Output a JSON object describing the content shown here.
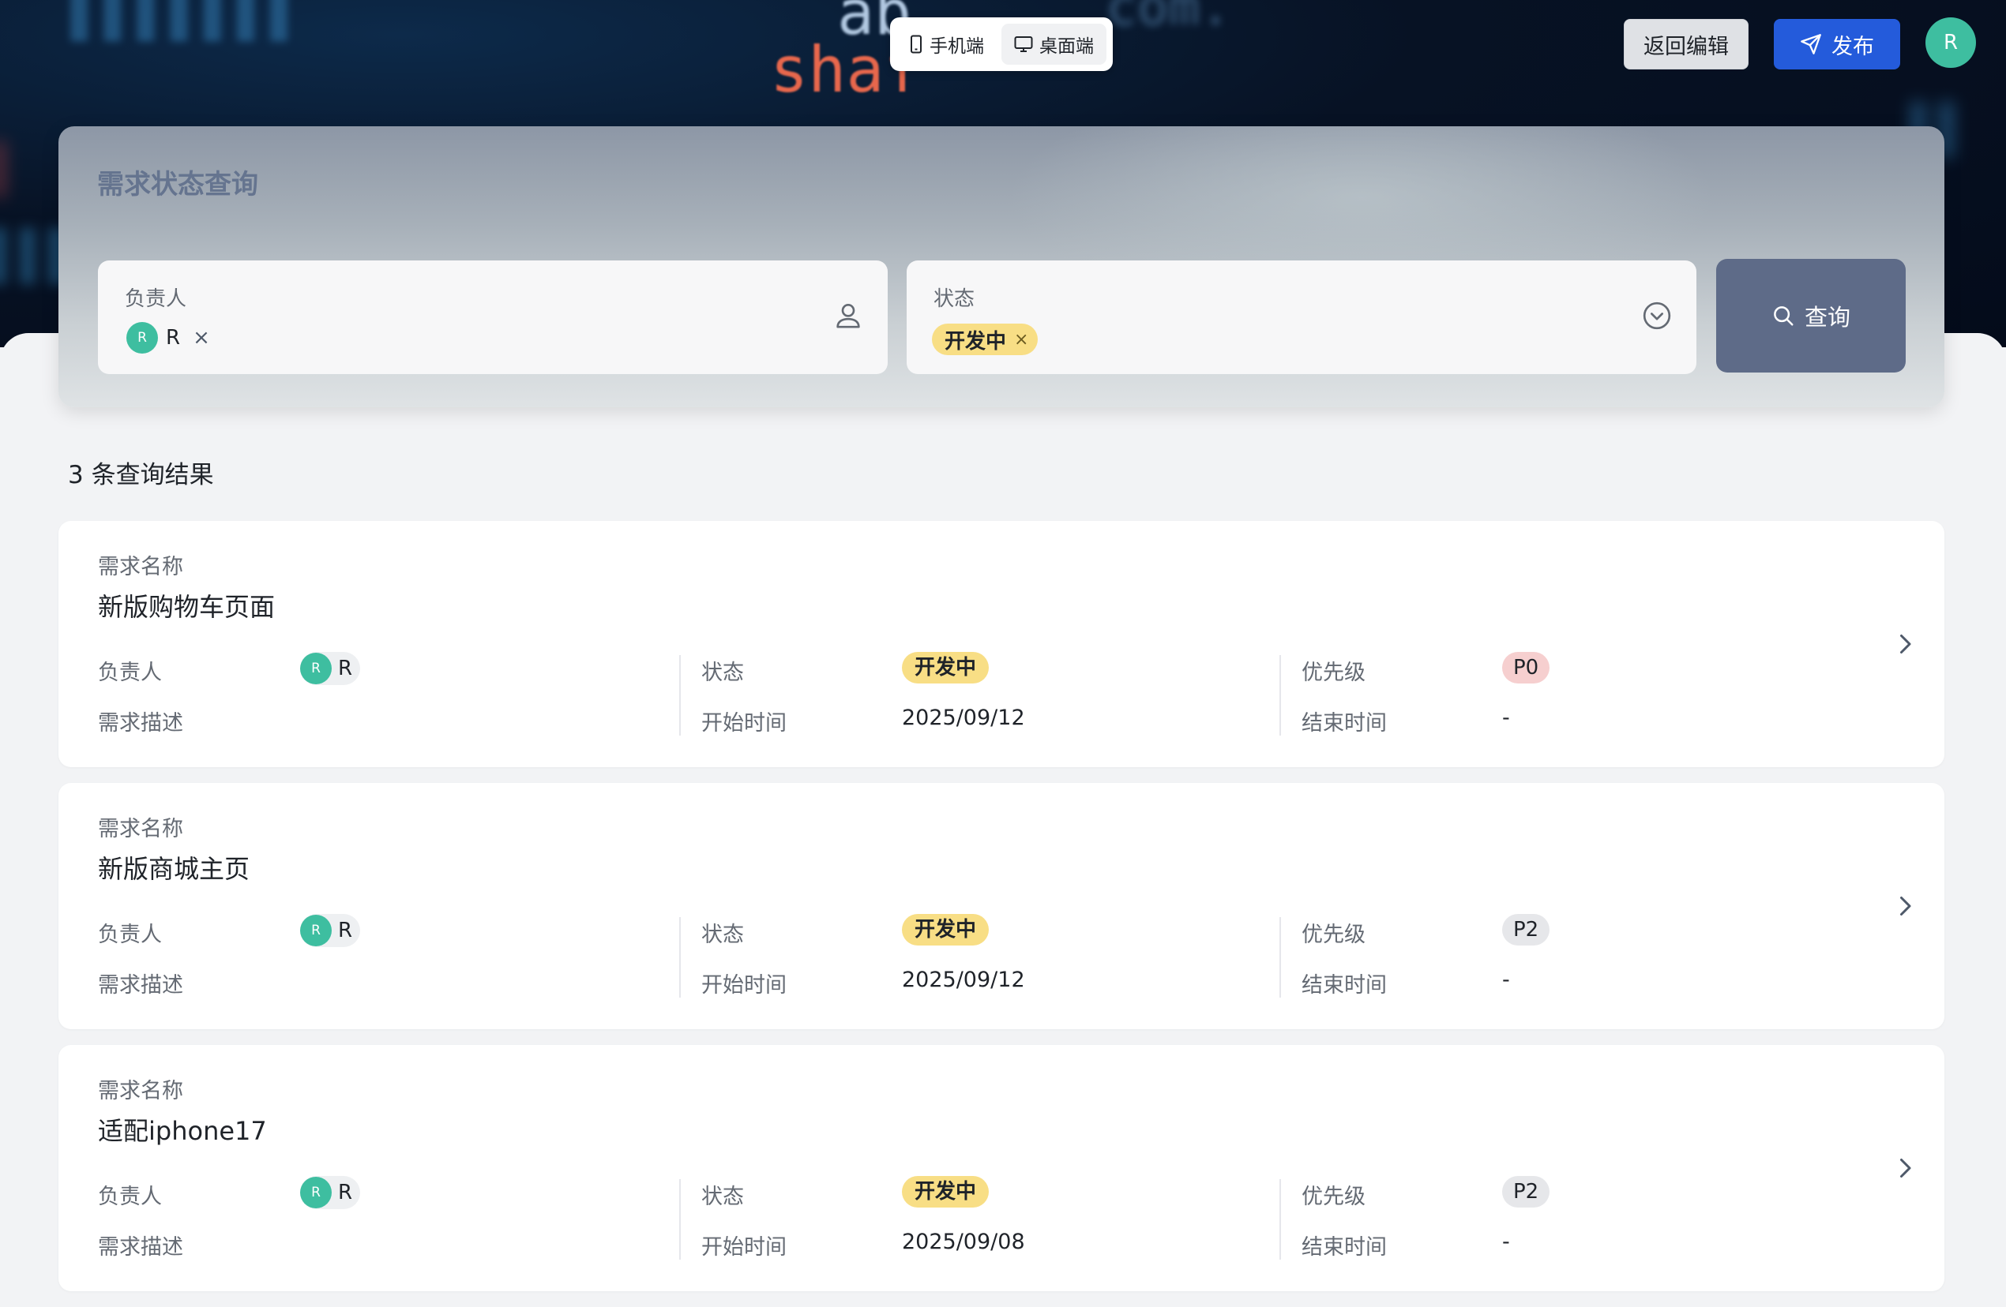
{
  "banner": {
    "deco": [
      "ab",
      "shaf",
      "com."
    ]
  },
  "header": {
    "view_toggle": [
      {
        "label": "手机端",
        "icon": "mobile-icon",
        "active": false
      },
      {
        "label": "桌面端",
        "icon": "desktop-icon",
        "active": true
      }
    ],
    "back_label": "返回编辑",
    "publish_label": "发布",
    "user_initial": "R"
  },
  "query": {
    "title": "需求状态查询",
    "owner": {
      "label": "负责人",
      "tag_initial": "R",
      "tag_text": "R",
      "remove": "×"
    },
    "status": {
      "label": "状态",
      "tag_text": "开发中",
      "remove": "×"
    },
    "search_label": "查询"
  },
  "results": {
    "count_text": "3 条查询结果",
    "labels": {
      "name": "需求名称",
      "owner": "负责人",
      "desc": "需求描述",
      "status": "状态",
      "start": "开始时间",
      "priority": "优先级",
      "end": "结束时间"
    },
    "items": [
      {
        "name": "新版购物车页面",
        "owner_initial": "R",
        "owner": "R",
        "status": "开发中",
        "start": "2025/09/12",
        "priority": "P0",
        "priority_color": "#f6cfcf",
        "end": "-"
      },
      {
        "name": "新版商城主页",
        "owner_initial": "R",
        "owner": "R",
        "status": "开发中",
        "start": "2025/09/12",
        "priority": "P2",
        "priority_color": "#e6e7ea",
        "end": "-"
      },
      {
        "name": "适配iphone17",
        "owner_initial": "R",
        "owner": "R",
        "status": "开发中",
        "start": "2025/09/08",
        "priority": "P2",
        "priority_color": "#e6e7ea",
        "end": "-"
      }
    ]
  },
  "colors": {
    "accent": "#245bdb",
    "status_badge": "#f8de85",
    "avatar": "#3ebea0",
    "query_button": "#5e6b88"
  }
}
